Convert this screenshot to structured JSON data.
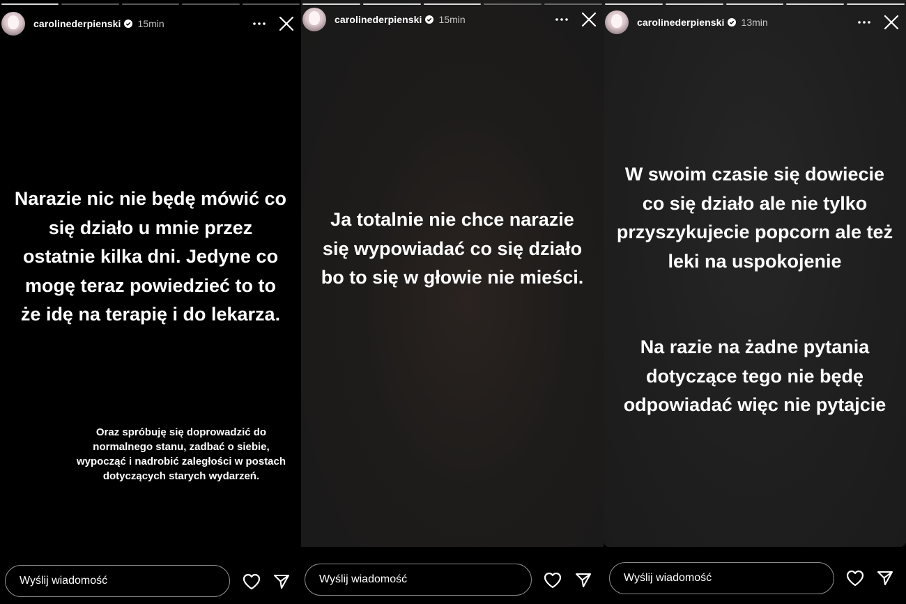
{
  "stories": [
    {
      "username": "carolinederpienski",
      "time": "15min",
      "progress_total": 5,
      "progress_done": 1,
      "text_main": "Narazie nic nie będę mówić co się działo u mnie przez ostatnie kilka dni. Jedyne co mogę teraz powiedzieć to to że idę na terapię i do lekarza.",
      "text_small": "Oraz spróbuję się doprowadzić do normalnego stanu, zadbać o siebie, wypocząć i nadrobić zaległości w postach dotyczących starych wydarzeń.",
      "message_placeholder": "Wyślij wiadomość"
    },
    {
      "username": "carolinederpienski",
      "time": "15min",
      "progress_total": 5,
      "progress_done": 3,
      "text_main": "Ja totalnie nie chce narazie się wypowiadać co się działo bo to się w głowie nie mieści.",
      "message_placeholder": "Wyślij wiadomość"
    },
    {
      "username": "carolinederpienski",
      "time": "13min",
      "progress_total": 5,
      "progress_done": 5,
      "text_main": "W swoim czasie się dowiecie co się działo ale nie tylko przyszykujecie popcorn ale też leki na uspokojenie",
      "text_main2": "Na razie na żadne pytania dotyczące tego nie będę odpowiadać więc nie pytajcie",
      "message_placeholder": "Wyślij wiadomość"
    }
  ],
  "icons": {
    "verified": "verified-badge-icon",
    "more": "more-horizontal-icon",
    "close": "close-icon",
    "heart": "heart-icon",
    "send": "send-icon"
  }
}
